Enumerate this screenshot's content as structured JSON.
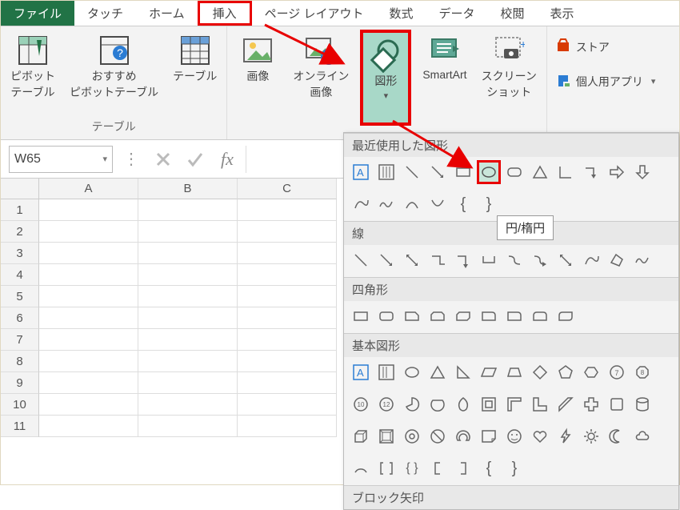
{
  "menu": {
    "file": "ファイル",
    "items": [
      "タッチ",
      "ホーム",
      "挿入",
      "ページ レイアウト",
      "数式",
      "データ",
      "校閲",
      "表示"
    ],
    "active_index": 2
  },
  "ribbon": {
    "tables": {
      "pivot_table": "ピボット\nテーブル",
      "recommended_pivot": "おすすめ\nピボットテーブル",
      "table": "テーブル",
      "group_label": "テーブル"
    },
    "illust": {
      "pictures": "画像",
      "online_pictures": "オンライン\n画像",
      "shapes": "図形",
      "smartart": "SmartArt",
      "screenshot": "スクリーン\nショット"
    },
    "apps": {
      "store": "ストア",
      "my_apps": "個人用アプリ"
    }
  },
  "namebox": {
    "value": "W65"
  },
  "columns": [
    "A",
    "B",
    "C"
  ],
  "rows": [
    "1",
    "2",
    "3",
    "4",
    "5",
    "6",
    "7",
    "8",
    "9",
    "10",
    "11"
  ],
  "gallery": {
    "sections": {
      "recent": "最近使用した図形",
      "lines": "線",
      "rects": "四角形",
      "basic": "基本図形",
      "block": "ブロック矢印"
    }
  },
  "tooltip": "円/楕円"
}
